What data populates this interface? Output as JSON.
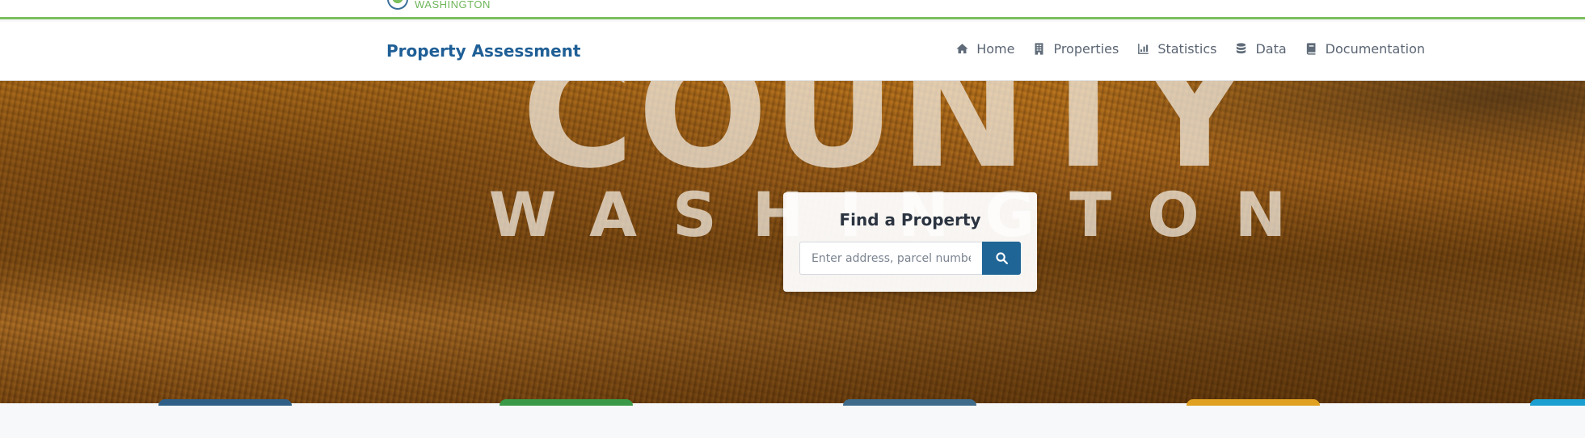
{
  "top_logo": {
    "text": "WASHINGTON",
    "icon": "county-seal-icon"
  },
  "navbar": {
    "brand": "Property Assessment",
    "items": [
      {
        "label": "Home",
        "icon": "home-icon"
      },
      {
        "label": "Properties",
        "icon": "building-icon"
      },
      {
        "label": "Statistics",
        "icon": "bar-chart-icon"
      },
      {
        "label": "Data",
        "icon": "database-icon"
      },
      {
        "label": "Documentation",
        "icon": "book-icon"
      }
    ]
  },
  "hero": {
    "watermark_line1": "COUNTY",
    "watermark_line2": "WASHINGTON"
  },
  "search": {
    "title": "Find a Property",
    "placeholder": "Enter address, parcel number",
    "button_icon": "search-icon"
  },
  "colors": {
    "brand": "#1f5f96",
    "accent_green": "#7cbf5e",
    "search_button": "#1f6596",
    "tab_peeks": [
      "#2f5f86",
      "#3a9a47",
      "#3f6b8a",
      "#e0a020",
      "#1a9fd0"
    ]
  }
}
